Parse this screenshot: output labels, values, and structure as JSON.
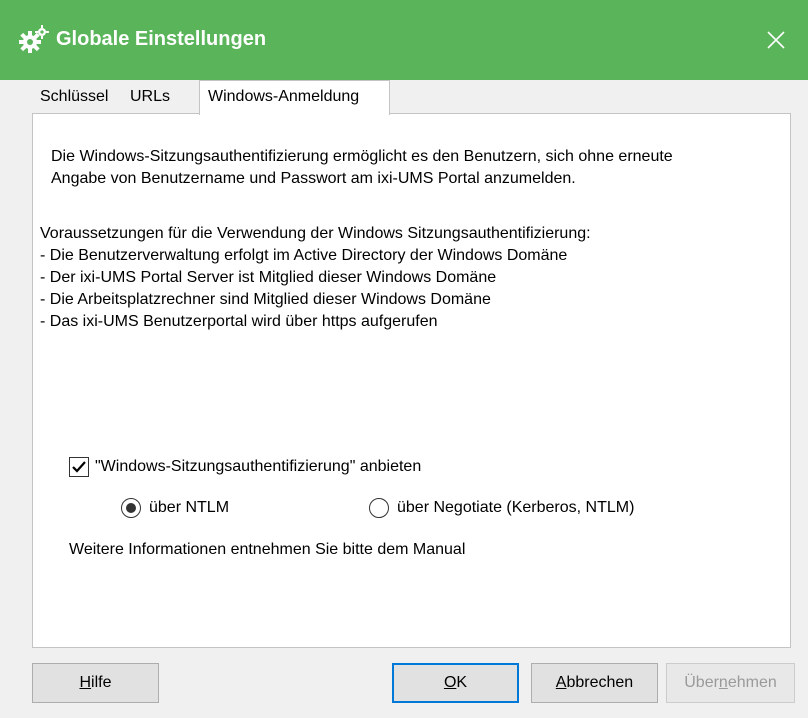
{
  "window": {
    "title": "Globale Einstellungen",
    "icon": "gears-icon",
    "close_icon": "close-icon"
  },
  "tabs": [
    {
      "label": "Schlüssel",
      "active": false
    },
    {
      "label": "URLs",
      "active": false
    },
    {
      "label": "Windows-Anmeldung",
      "active": true
    }
  ],
  "panel": {
    "intro_line1": "Die Windows-Sitzungsauthentifizierung ermöglicht es den Benutzern, sich ohne erneute",
    "intro_line2": "Angabe von Benutzername und Passwort am ixi-UMS Portal anzumelden.",
    "requirements_heading": "Voraussetzungen für die Verwendung der Windows Sitzungsauthentifizierung:",
    "requirements": [
      "- Die Benutzerverwaltung erfolgt im Active Directory der Windows Domäne",
      "- Der ixi-UMS Portal Server ist Mitglied dieser Windows Domäne",
      "- Die Arbeitsplatzrechner sind Mitglied dieser Windows Domäne",
      "- Das ixi-UMS Benutzerportal wird über https aufgerufen"
    ],
    "offer_checkbox": {
      "label": "\"Windows-Sitzungsauthentifizierung\" anbieten",
      "checked": true
    },
    "radio_ntlm": {
      "label": "über NTLM",
      "checked": true
    },
    "radio_negotiate": {
      "label": "über Negotiate (Kerberos, NTLM)",
      "checked": false
    },
    "info_text": "Weitere Informationen entnehmen Sie bitte dem Manual"
  },
  "buttons": {
    "help": {
      "pre": "",
      "mnemonic": "H",
      "post": "ilfe"
    },
    "ok": {
      "pre": "",
      "mnemonic": "O",
      "post": "K"
    },
    "cancel": {
      "pre": "",
      "mnemonic": "A",
      "post": "bbrechen"
    },
    "apply": {
      "pre": "Über",
      "mnemonic": "n",
      "post": "ehmen",
      "enabled": false
    }
  },
  "colors": {
    "titlebar": "#5ab45a",
    "accent": "#0078d7"
  }
}
